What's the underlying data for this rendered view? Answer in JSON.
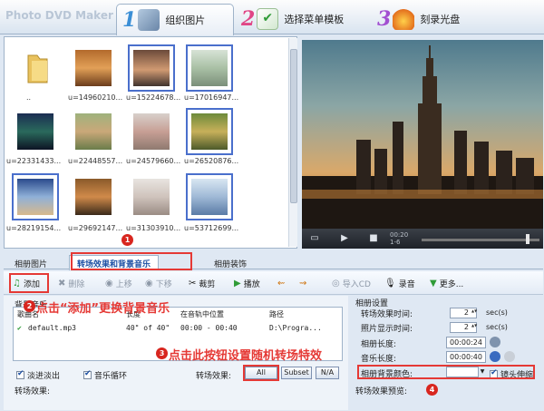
{
  "app": {
    "title": "Photo DVD Maker"
  },
  "steps": [
    {
      "num": "1",
      "label": "组织图片"
    },
    {
      "num": "2",
      "label": "选择菜单模板"
    },
    {
      "num": "3",
      "label": "刻录光盘"
    }
  ],
  "thumbnails": [
    {
      "caption": "..",
      "kind": "folder"
    },
    {
      "caption": "u=14960210...",
      "kind": "photo"
    },
    {
      "caption": "u=15224678...",
      "kind": "photo"
    },
    {
      "caption": "u=17016947...",
      "kind": "photo"
    },
    {
      "caption": "u=22331433...",
      "kind": "photo"
    },
    {
      "caption": "u=22448557...",
      "kind": "photo"
    },
    {
      "caption": "u=24579660...",
      "kind": "photo"
    },
    {
      "caption": "u=26520876...",
      "kind": "photo"
    },
    {
      "caption": "u=28219154...",
      "kind": "photo"
    },
    {
      "caption": "u=29692147...",
      "kind": "photo"
    },
    {
      "caption": "u=31303910...",
      "kind": "photo"
    },
    {
      "caption": "u=53712699...",
      "kind": "photo"
    }
  ],
  "player": {
    "time_line1": "00:20",
    "time_line2": "1-6"
  },
  "tabs": {
    "pictures": "相册图片",
    "transitions_music": "转场效果和背景音乐",
    "decoration": "相册装饰"
  },
  "toolbar": {
    "add": "添加",
    "delete": "删除",
    "move_up": "上移",
    "move_down": "下移",
    "cut": "裁剪",
    "play": "播放",
    "import_cd": "导入CD",
    "record": "录音",
    "more": "更多..."
  },
  "music_list": {
    "label": "背景音乐",
    "headers": [
      "歌曲名",
      "长度",
      "在音轨中位置",
      "路径"
    ],
    "rows": [
      {
        "name": "default.mp3",
        "length": "40\" of 40\"",
        "position": "00:00 - 00:40",
        "path": "D:\\Progra..."
      }
    ]
  },
  "options": {
    "fade": "淡进淡出",
    "loop": "音乐循环"
  },
  "transition": {
    "label": "转场效果:",
    "all": "All",
    "subset": "Subset",
    "na": "N/A",
    "effect_label": "转场效果:"
  },
  "settings": {
    "title": "相册设置",
    "transition_time_label": "转场效果时间:",
    "transition_time": "2",
    "unit_sec": "sec(s)",
    "photo_time_label": "照片显示时间:",
    "photo_time": "2",
    "album_length_label": "相册长度:",
    "album_length": "00:00:24",
    "music_length_label": "音乐长度:",
    "music_length": "00:00:40",
    "bg_color_label": "相册背景颜色:",
    "lens_stretch": "镜头伸缩",
    "preview_label": "转场效果预览:"
  },
  "annotations": {
    "tip_add": "点击“添加”更换背景音乐",
    "tip_random": "点击此按钮设置随机转场特效",
    "b1": "1",
    "b2": "2",
    "b3": "3",
    "b4": "4"
  },
  "colors": {
    "annotation": "#e53935",
    "accent": "#1c4fa3"
  }
}
